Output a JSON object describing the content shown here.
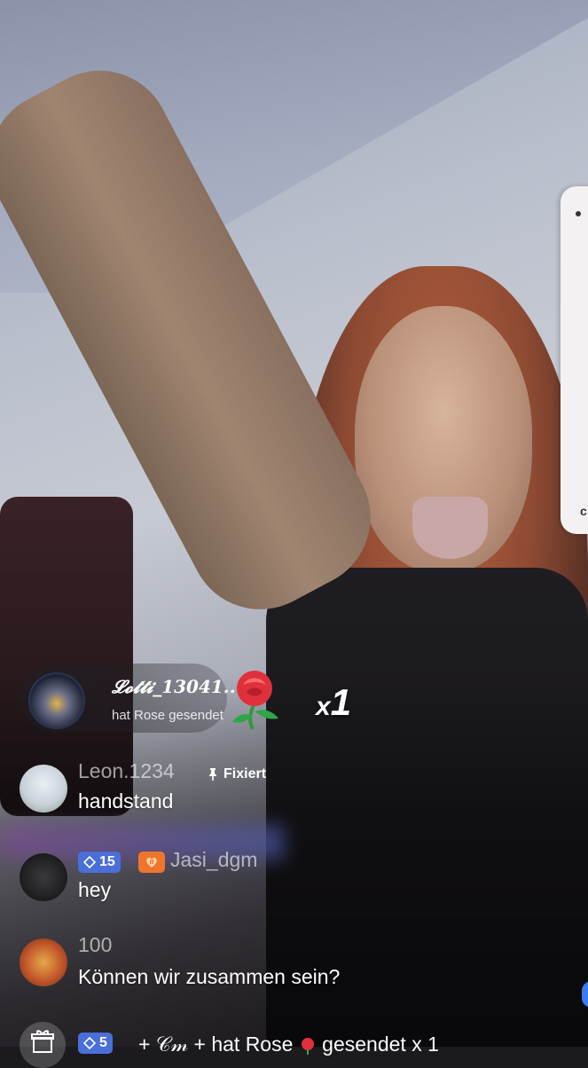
{
  "gift_banner": {
    "sender": "𝓛𝓸𝓽𝓽𝓲_13041...",
    "action": "hat Rose  gesendet",
    "count_prefix": "x",
    "count": "1"
  },
  "comments": [
    {
      "username": "Leon.1234",
      "pinned_label": "Fixiert",
      "text": "handstand"
    },
    {
      "username": "Jasi_dgm",
      "level": "15",
      "text": "hey"
    },
    {
      "username": "100",
      "text": "Können wir zusammen sein?"
    }
  ],
  "bottom_notice": {
    "level": "5",
    "text": "+ 𝒞𝓂 + hat Rose",
    "text_suffix": " gesendet x 1"
  },
  "side_card": {
    "letter": "c"
  },
  "colors": {
    "level_badge": "#4a6fd9",
    "fan_badge": "#f0752c",
    "rose": "#e0303c"
  }
}
